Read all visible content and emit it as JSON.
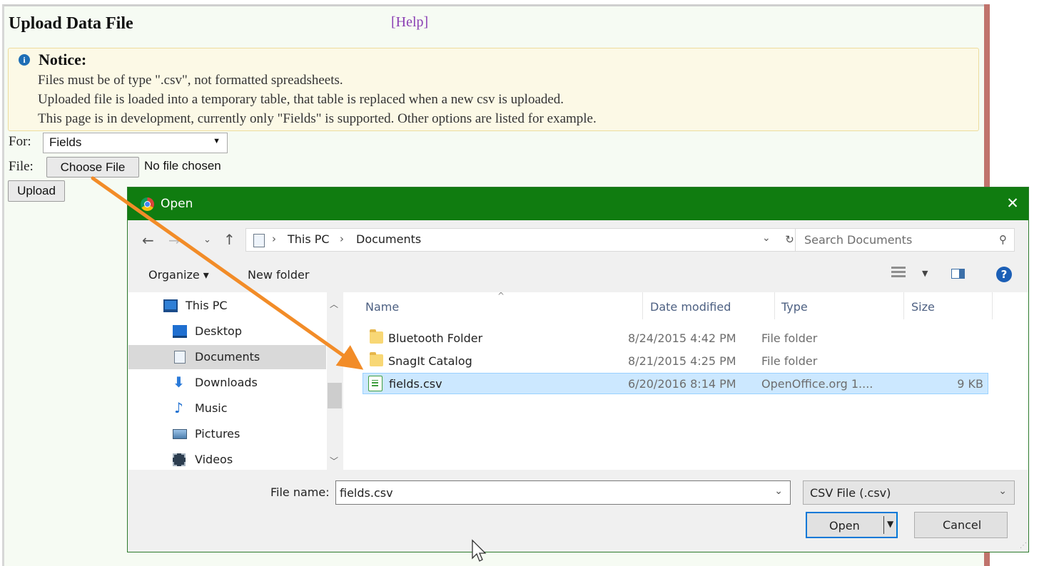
{
  "page": {
    "title": "Upload Data File",
    "help_link": "[Help]",
    "notice": {
      "title": "Notice:",
      "lines": [
        "Files must be of type \".csv\", not formatted spreadsheets.",
        "Uploaded file is loaded into a temporary table, that table is replaced when a new csv is uploaded.",
        "This page is in development, currently only \"Fields\" is supported. Other options are listed for example."
      ]
    },
    "form": {
      "for_label": "For:",
      "for_value": "Fields",
      "file_label": "File:",
      "choose_file": "Choose File",
      "no_file": "No file chosen",
      "upload": "Upload"
    }
  },
  "dialog": {
    "title": "Open",
    "address": {
      "segments": [
        "This PC",
        "Documents"
      ]
    },
    "search_placeholder": "Search Documents",
    "toolbar": {
      "organize": "Organize ▾",
      "new_folder": "New folder"
    },
    "nav_items": [
      {
        "label": "This PC",
        "icon": "computer-icon"
      },
      {
        "label": "Desktop",
        "icon": "desktop-icon"
      },
      {
        "label": "Documents",
        "icon": "documents-icon",
        "selected": true
      },
      {
        "label": "Downloads",
        "icon": "downloads-icon"
      },
      {
        "label": "Music",
        "icon": "music-icon"
      },
      {
        "label": "Pictures",
        "icon": "pictures-icon"
      },
      {
        "label": "Videos",
        "icon": "videos-icon"
      }
    ],
    "columns": [
      "Name",
      "Date modified",
      "Type",
      "Size"
    ],
    "files": [
      {
        "name": "Bluetooth Folder",
        "date": "8/24/2015 4:42 PM",
        "type": "File folder",
        "size": "",
        "icon": "folder-icon"
      },
      {
        "name": "SnagIt Catalog",
        "date": "8/21/2015 4:25 PM",
        "type": "File folder",
        "size": "",
        "icon": "folder-icon"
      },
      {
        "name": "fields.csv",
        "date": "6/20/2016 8:14 PM",
        "type": "OpenOffice.org 1....",
        "size": "9 KB",
        "icon": "csv-file-icon",
        "selected": true
      }
    ],
    "file_name_label": "File name:",
    "file_name_value": "fields.csv",
    "file_type": "CSV File (.csv)",
    "open_button": "Open",
    "cancel_button": "Cancel"
  },
  "colors": {
    "titlebar": "#107c10",
    "annotation_arrow": "#f28c28",
    "selection": "#cce8ff",
    "page_bg": "#f6fbf3",
    "help_link": "#8b3fb4"
  }
}
